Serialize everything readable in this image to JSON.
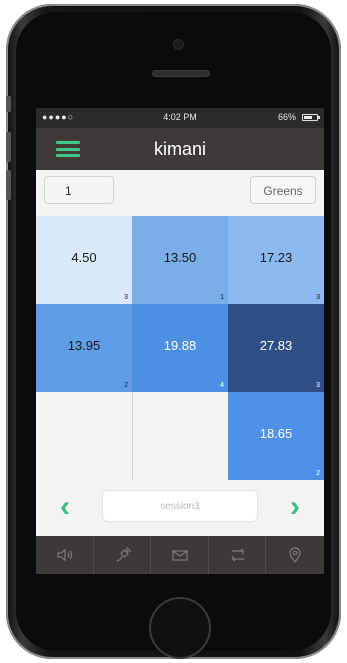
{
  "status_bar": {
    "signal": "●●●●○",
    "time": "4:02 PM",
    "battery_text": "66%",
    "battery_level": 0.66
  },
  "nav": {
    "title": "kimani"
  },
  "controls": {
    "input_value": "1",
    "greens_label": "Greens"
  },
  "grid": {
    "cells": [
      {
        "value": "4.50",
        "count": "3",
        "color": "#d9e9fa"
      },
      {
        "value": "13.50",
        "count": "1",
        "color": "#79aee6"
      },
      {
        "value": "17.23",
        "count": "3",
        "color": "#8abaee"
      },
      {
        "value": "13.95",
        "count": "2",
        "color": "#5f9ee6"
      },
      {
        "value": "19.88",
        "count": "4",
        "color": "#4d8fe3"
      },
      {
        "value": "27.83",
        "count": "3",
        "color": "#2f4f86"
      },
      {
        "value": "18.65",
        "count": "2",
        "color": "#4f90e6"
      }
    ]
  },
  "pager": {
    "session_placeholder": "session3",
    "prev_icon": "chevron-left-icon",
    "next_icon": "chevron-right-icon"
  },
  "tabs": [
    {
      "icon": "speaker-icon"
    },
    {
      "icon": "satellite-icon"
    },
    {
      "icon": "mail-icon"
    },
    {
      "icon": "transfer-icon"
    },
    {
      "icon": "location-pin-icon"
    }
  ],
  "colors": {
    "accent": "#36c27e",
    "navbar": "#3e3a36",
    "tabbar": "#3d3935"
  }
}
